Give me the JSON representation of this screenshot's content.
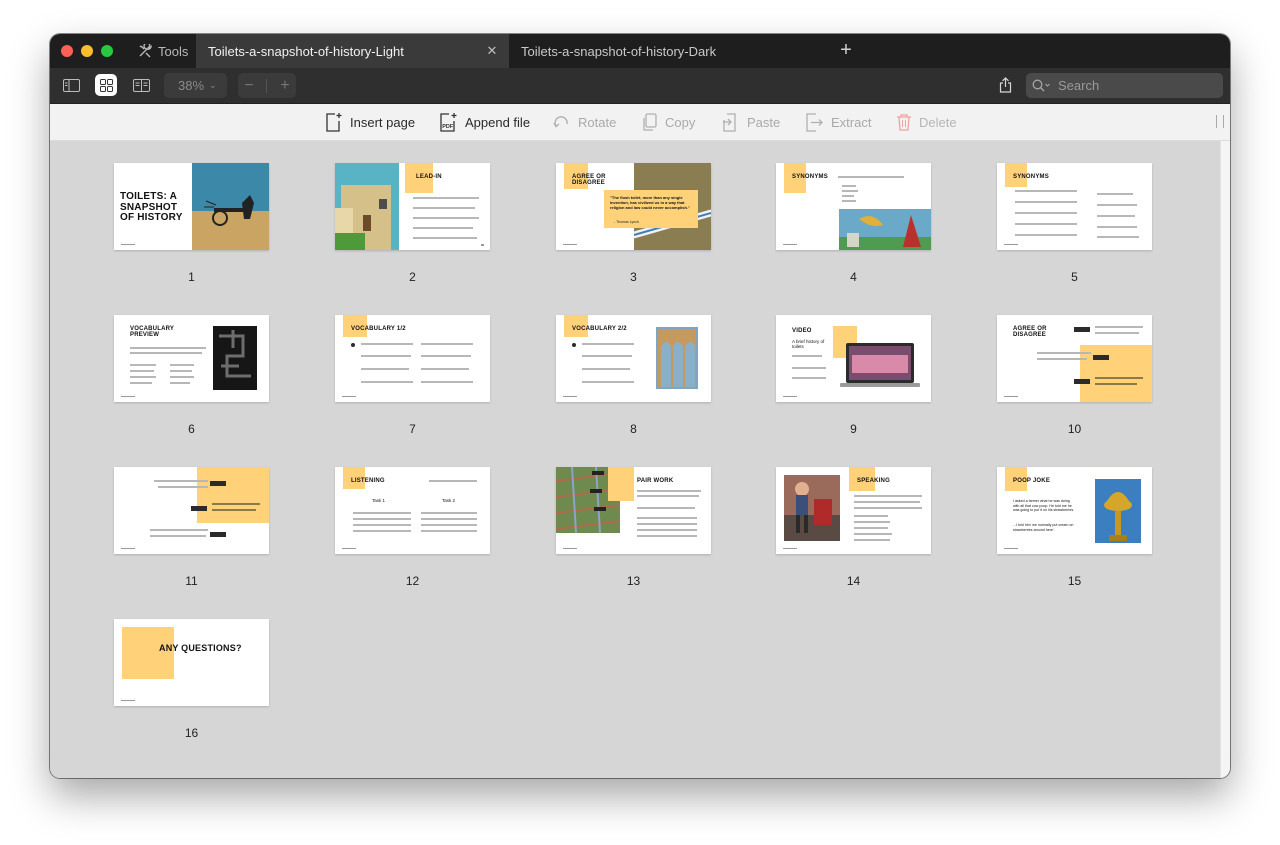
{
  "window": {
    "tools_label": "Tools",
    "tabs": [
      {
        "label": "Toilets-a-snapshot-of-history-Light",
        "active": true
      },
      {
        "label": "Toilets-a-snapshot-of-history-Dark",
        "active": false
      }
    ]
  },
  "toolbar": {
    "zoom_value": "38%",
    "search_placeholder": "Search"
  },
  "actions": {
    "insert_page": "Insert page",
    "append_file": "Append file",
    "rotate": "Rotate",
    "copy": "Copy",
    "paste": "Paste",
    "extract": "Extract",
    "delete": "Delete"
  },
  "pages": {
    "numbers": [
      "1",
      "2",
      "3",
      "4",
      "5",
      "6",
      "7",
      "8",
      "9",
      "10",
      "11",
      "12",
      "13",
      "14",
      "15",
      "16"
    ],
    "titles": {
      "p1": "TOILETS: A SNAPSHOT OF HISTORY",
      "p2": "LEAD-IN",
      "p3": "AGREE OR DISAGREE",
      "p4": "SYNONYMS",
      "p5": "SYNONYMS",
      "p6": "VOCABULARY PREVIEW",
      "p7": "VOCABULARY 1/2",
      "p8": "VOCABULARY 2/2",
      "p9": "VIDEO",
      "p10": "AGREE OR DISAGREE",
      "p12": "LISTENING",
      "p13": "PAIR WORK",
      "p14": "SPEAKING",
      "p15": "POOP JOKE",
      "p16": "ANY QUESTIONS?"
    },
    "texts": {
      "p3_quote": "\"The flush toilet, more than any single invention, has civilized us in a way that religion and law could never accomplish.\"",
      "p3_author": "- Thomas Lynch",
      "p9_subtitle": "A brief history of toilets",
      "p12_task1": "Task 1",
      "p12_task2": "Task 2",
      "p15_line1": "I asked a farmer what he was doing with all that cow poop. He told me he was going to put it on his strawberries.",
      "p15_line2": "...I told him 'we normally put cream on strawberries around here'."
    }
  },
  "colors": {
    "accent": "#ffd27a",
    "titlebar": "#1e1e1e",
    "toolbar": "#2f2f2f",
    "canvas": "#d6d6d6"
  }
}
